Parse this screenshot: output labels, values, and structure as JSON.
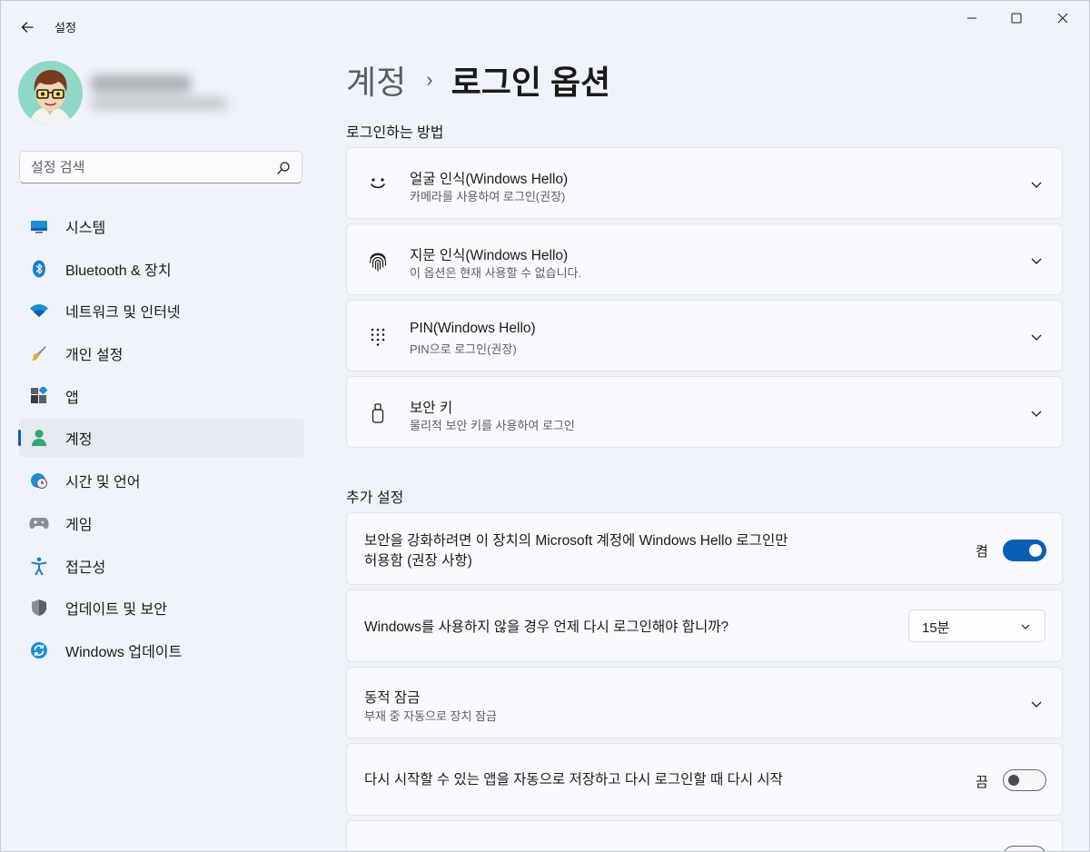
{
  "window": {
    "title": "설정"
  },
  "search": {
    "placeholder": "설정 검색"
  },
  "sidebar": {
    "items": [
      {
        "label": "시스템",
        "icon": "monitor-icon"
      },
      {
        "label": "Bluetooth & 장치",
        "icon": "bluetooth-icon"
      },
      {
        "label": "네트워크 및 인터넷",
        "icon": "wifi-icon"
      },
      {
        "label": "개인 설정",
        "icon": "brush-icon"
      },
      {
        "label": "앱",
        "icon": "apps-icon"
      },
      {
        "label": "계정",
        "icon": "person-icon",
        "active": true
      },
      {
        "label": "시간 및 언어",
        "icon": "globe-clock-icon"
      },
      {
        "label": "게임",
        "icon": "gamepad-icon"
      },
      {
        "label": "접근성",
        "icon": "accessibility-icon"
      },
      {
        "label": "업데이트 및 보안",
        "icon": "shield-icon"
      },
      {
        "label": "Windows 업데이트",
        "icon": "sync-icon"
      }
    ]
  },
  "breadcrumb": {
    "parent": "계정",
    "separator": "›",
    "current": "로그인 옵션"
  },
  "sections": {
    "signin_methods": "로그인하는 방법",
    "additional": "추가 설정"
  },
  "methods": [
    {
      "title": "얼굴 인식(Windows Hello)",
      "subtitle": "카메라를 사용하여 로그인(권장)",
      "icon": "face-icon"
    },
    {
      "title": "지문 인식(Windows Hello)",
      "subtitle": "이 옵션은 현재 사용할 수 없습니다.",
      "icon": "fingerprint-icon"
    },
    {
      "title": "PIN(Windows Hello)",
      "subtitle": "PIN으로 로그인(권장)",
      "icon": "keypad-icon"
    },
    {
      "title": "보안 키",
      "subtitle": "물리적 보안 키를 사용하여 로그인",
      "icon": "usb-key-icon"
    }
  ],
  "settings": {
    "hello_only": {
      "line1": "보안을 강화하려면 이 장치의 Microsoft 계정에 Windows Hello 로그인만",
      "line2": "허용함 (권장 사항)",
      "state_label": "켬",
      "on": true
    },
    "require_signin": {
      "text": "Windows를 사용하지 않을 경우 언제 다시 로그인해야 합니까?",
      "value": "15분"
    },
    "dynamic_lock": {
      "title": "동적 잠금",
      "subtitle": "부재 중 자동으로 장치 잠금"
    },
    "restart_apps": {
      "text": "다시 시작할 수 있는 앱을 자동으로 저장하고 다시 로그인할 때 다시 시작",
      "state_label": "끔",
      "on": false
    }
  },
  "colors": {
    "accent": "#0a5fb4",
    "background": "#f0f3f9",
    "card": "#f9fafd"
  }
}
